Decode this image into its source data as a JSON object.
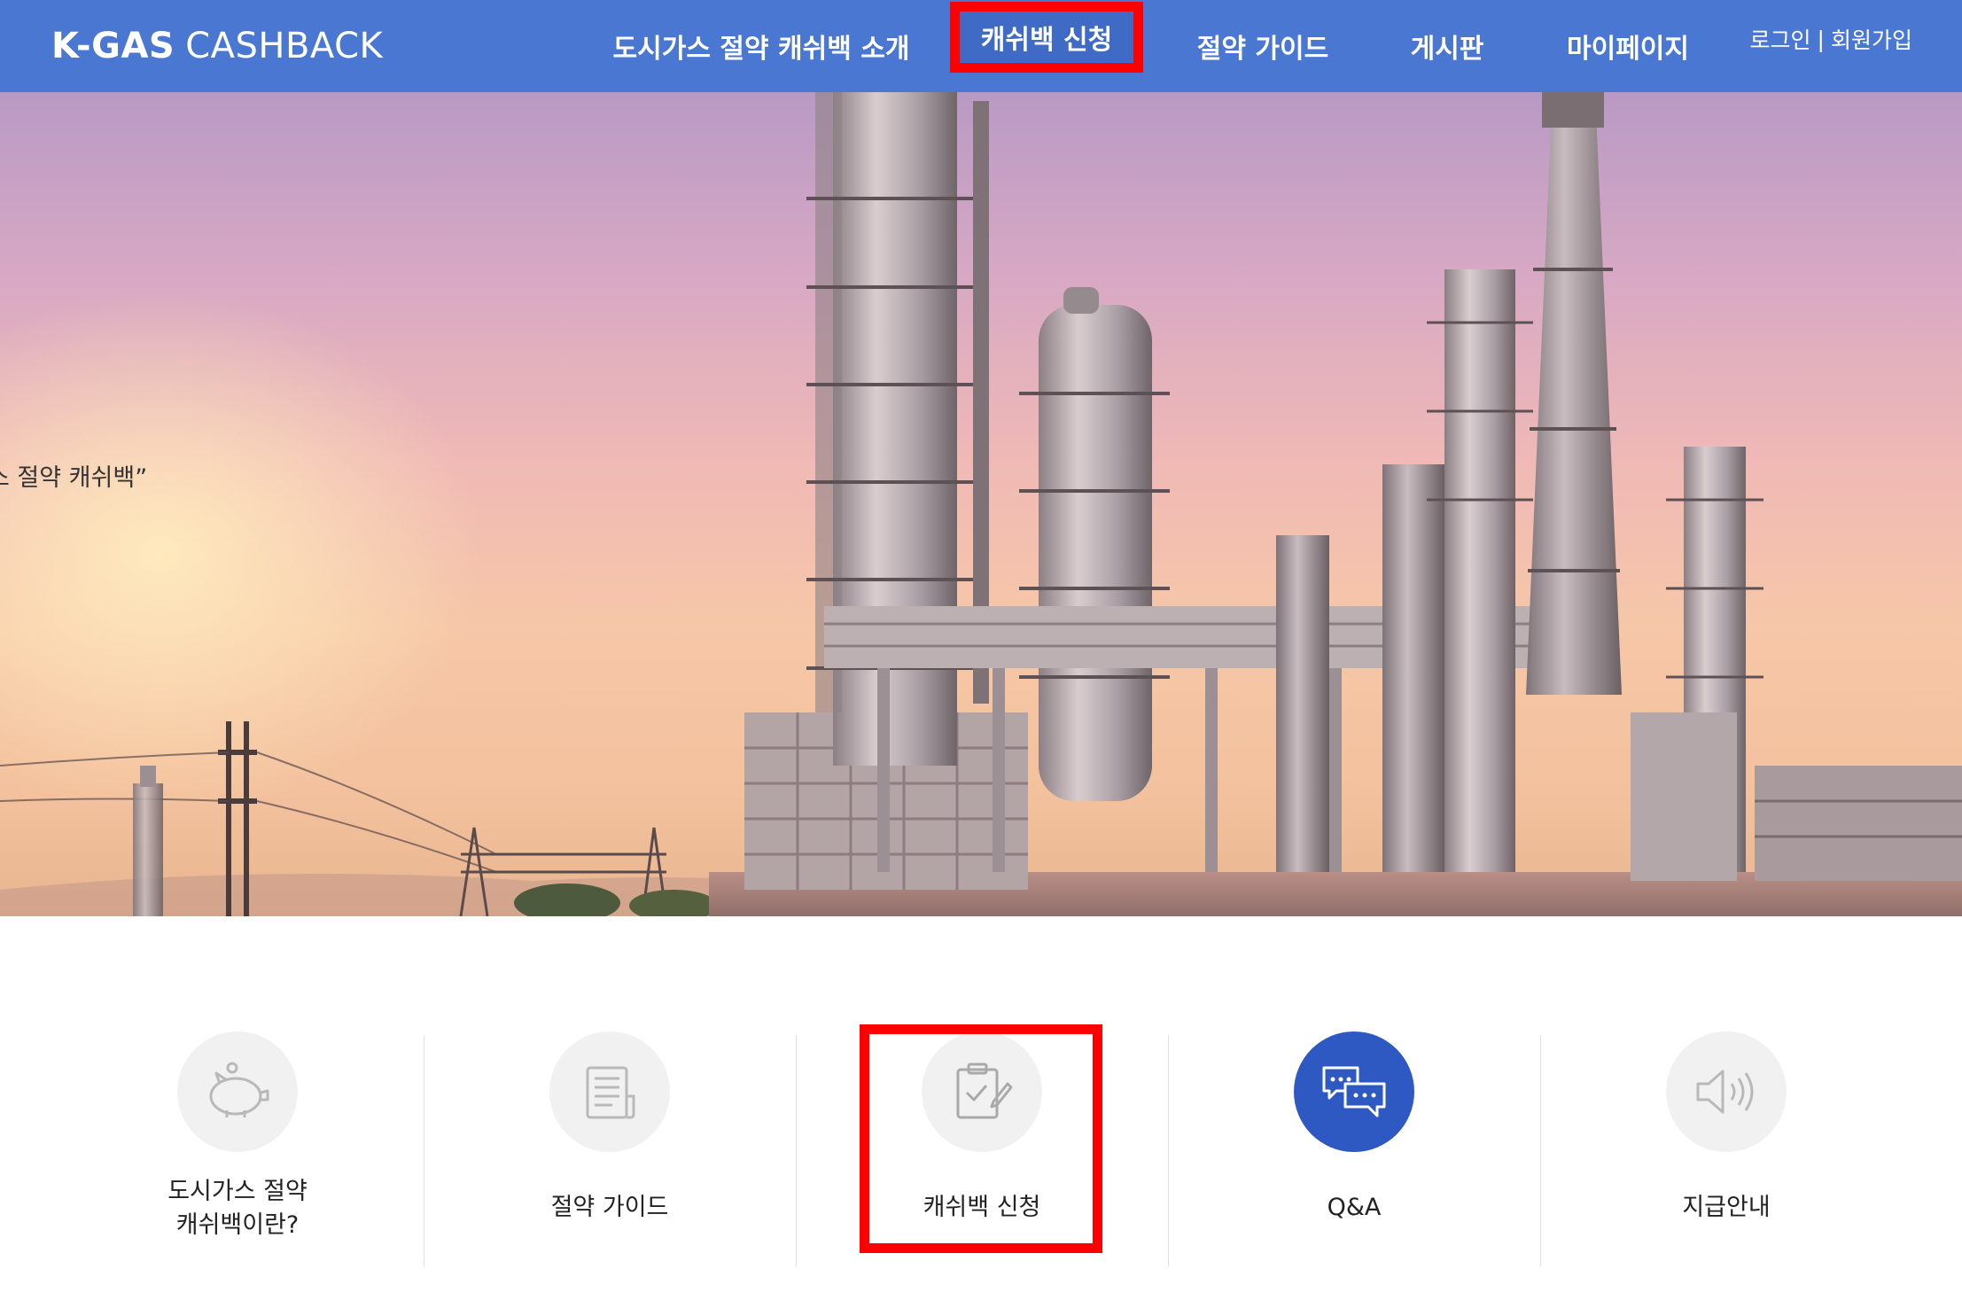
{
  "header": {
    "logo_bold": "K-GAS",
    "logo_light": "CASHBACK",
    "nav": [
      {
        "label": "도시가스 절약 캐쉬백 소개"
      },
      {
        "label": "캐쉬백 신청"
      },
      {
        "label": "절약 가이드"
      },
      {
        "label": "게시판"
      },
      {
        "label": "마이페이지"
      }
    ],
    "login": "로그인",
    "separator": "|",
    "signup": "회원가입"
  },
  "hero": {
    "caption": "스 절약 캐쉬백”"
  },
  "quick_menu": [
    {
      "label": "도시가스 절약\n캐쉬백이란?",
      "icon": "piggy-bank-icon"
    },
    {
      "label": "절약 가이드",
      "icon": "document-icon"
    },
    {
      "label": "캐쉬백 신청",
      "icon": "clipboard-check-icon"
    },
    {
      "label": "Q&A",
      "icon": "chat-bubbles-icon"
    },
    {
      "label": "지급안내",
      "icon": "speaker-icon"
    }
  ],
  "colors": {
    "header_bg": "#4a77d2",
    "highlight": "#ff0000",
    "qa_icon_bg": "#2e59c2",
    "icon_bg": "#f1f1f1"
  }
}
